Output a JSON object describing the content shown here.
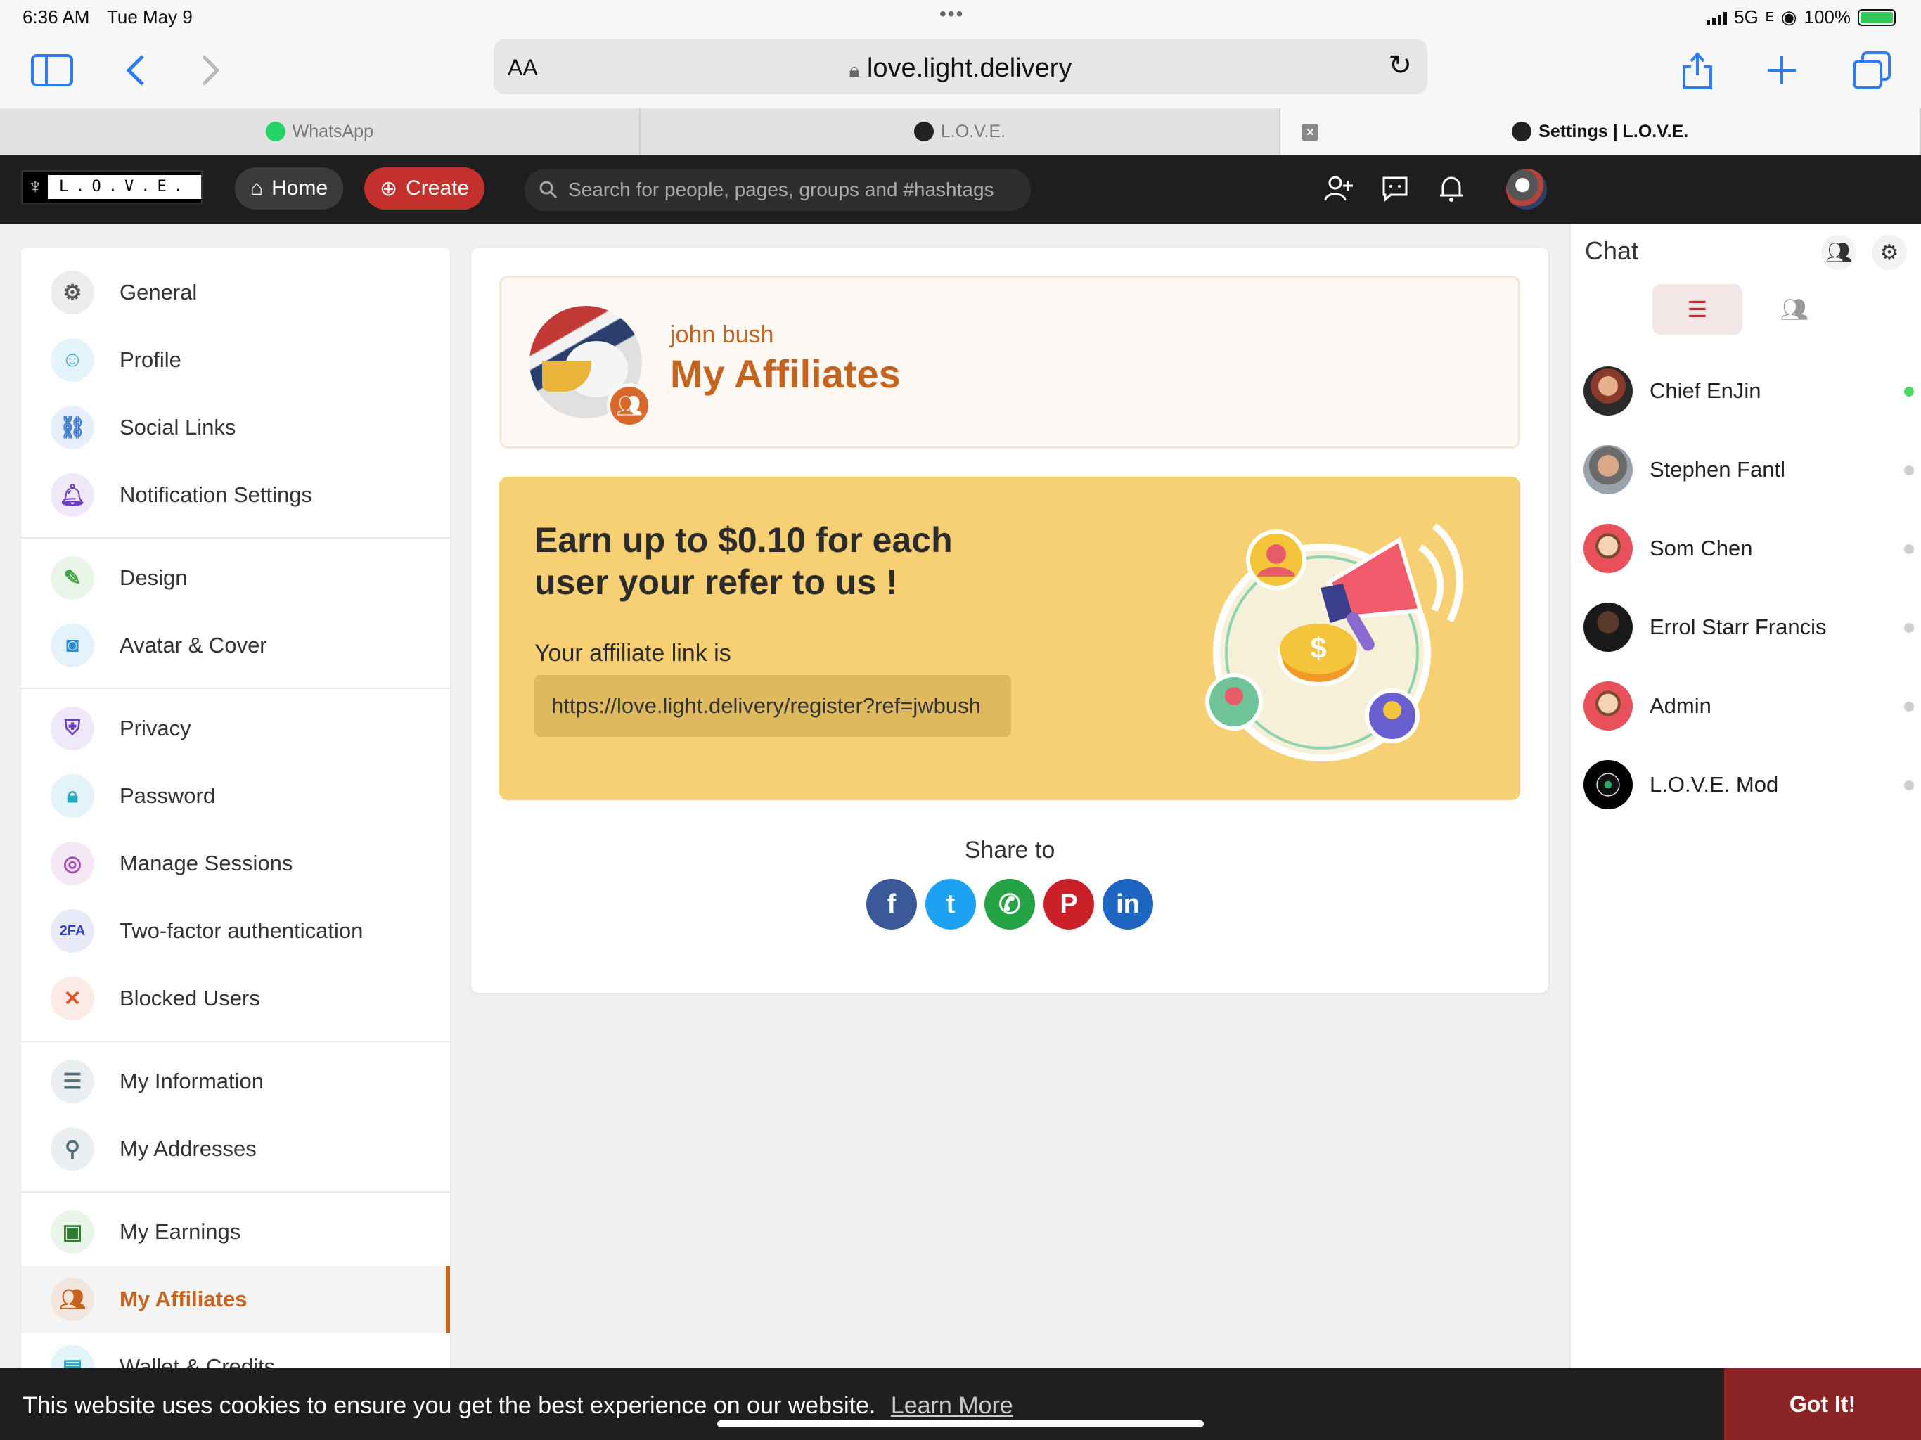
{
  "status_bar": {
    "time": "6:36 AM",
    "date": "Tue May 9",
    "network": "5G",
    "network_suffix": "E",
    "battery": "100%"
  },
  "browser": {
    "text_size_label": "AA",
    "url": "love.light.delivery",
    "tabs": [
      {
        "label": "WhatsApp"
      },
      {
        "label": "L.O.V.E."
      },
      {
        "label": "Settings | L.O.V.E."
      }
    ]
  },
  "site_header": {
    "logo_text": "L.O.V.E.",
    "home_label": "Home",
    "create_label": "Create",
    "search_placeholder": "Search for people, pages, groups and #hashtags"
  },
  "sidebar": {
    "items": [
      {
        "label": "General",
        "icon": "gear-icon"
      },
      {
        "label": "Profile",
        "icon": "face-icon"
      },
      {
        "label": "Social Links",
        "icon": "link-icon"
      },
      {
        "label": "Notification Settings",
        "icon": "bell-icon"
      },
      {
        "label": "Design",
        "icon": "brush-icon"
      },
      {
        "label": "Avatar & Cover",
        "icon": "camera-icon"
      },
      {
        "label": "Privacy",
        "icon": "shield-icon"
      },
      {
        "label": "Password",
        "icon": "lock-icon"
      },
      {
        "label": "Manage Sessions",
        "icon": "fingerprint-icon"
      },
      {
        "label": "Two-factor authentication",
        "icon": "2fa-icon"
      },
      {
        "label": "Blocked Users",
        "icon": "blocked-user-icon"
      },
      {
        "label": "My Information",
        "icon": "clipboard-icon"
      },
      {
        "label": "My Addresses",
        "icon": "location-pin-icon"
      },
      {
        "label": "My Earnings",
        "icon": "money-icon"
      },
      {
        "label": "My Affiliates",
        "icon": "group-icon"
      },
      {
        "label": "Wallet & Credits",
        "icon": "wallet-icon"
      }
    ],
    "active": "My Affiliates"
  },
  "main": {
    "username": "john bush",
    "page_title": "My Affiliates",
    "promo": {
      "headline": "Earn up to $0.10 for each user your refer to us !",
      "link_label": "Your affiliate link is",
      "link": "https://love.light.delivery/register?ref=jwbush"
    },
    "share_label": "Share to",
    "share_targets": [
      {
        "name": "facebook",
        "glyph": "f",
        "color": "#3b5998"
      },
      {
        "name": "twitter",
        "glyph": "t",
        "color": "#1da1f2"
      },
      {
        "name": "whatsapp",
        "glyph": "✆",
        "color": "#25a244"
      },
      {
        "name": "pinterest",
        "glyph": "P",
        "color": "#cb2027"
      },
      {
        "name": "linkedin",
        "glyph": "in",
        "color": "#1f66c2"
      }
    ]
  },
  "chat": {
    "title": "Chat",
    "contacts": [
      {
        "name": "Chief EnJin",
        "online": true
      },
      {
        "name": "Stephen Fantl",
        "online": false
      },
      {
        "name": "Som Chen",
        "online": false
      },
      {
        "name": "Errol Starr Francis",
        "online": false
      },
      {
        "name": "Admin",
        "online": false
      },
      {
        "name": "L.O.V.E. Mod",
        "online": false
      }
    ]
  },
  "cookie": {
    "text": "This website uses cookies to ensure you get the best experience on our website.",
    "learn_more": "Learn More",
    "button": "Got It!"
  }
}
